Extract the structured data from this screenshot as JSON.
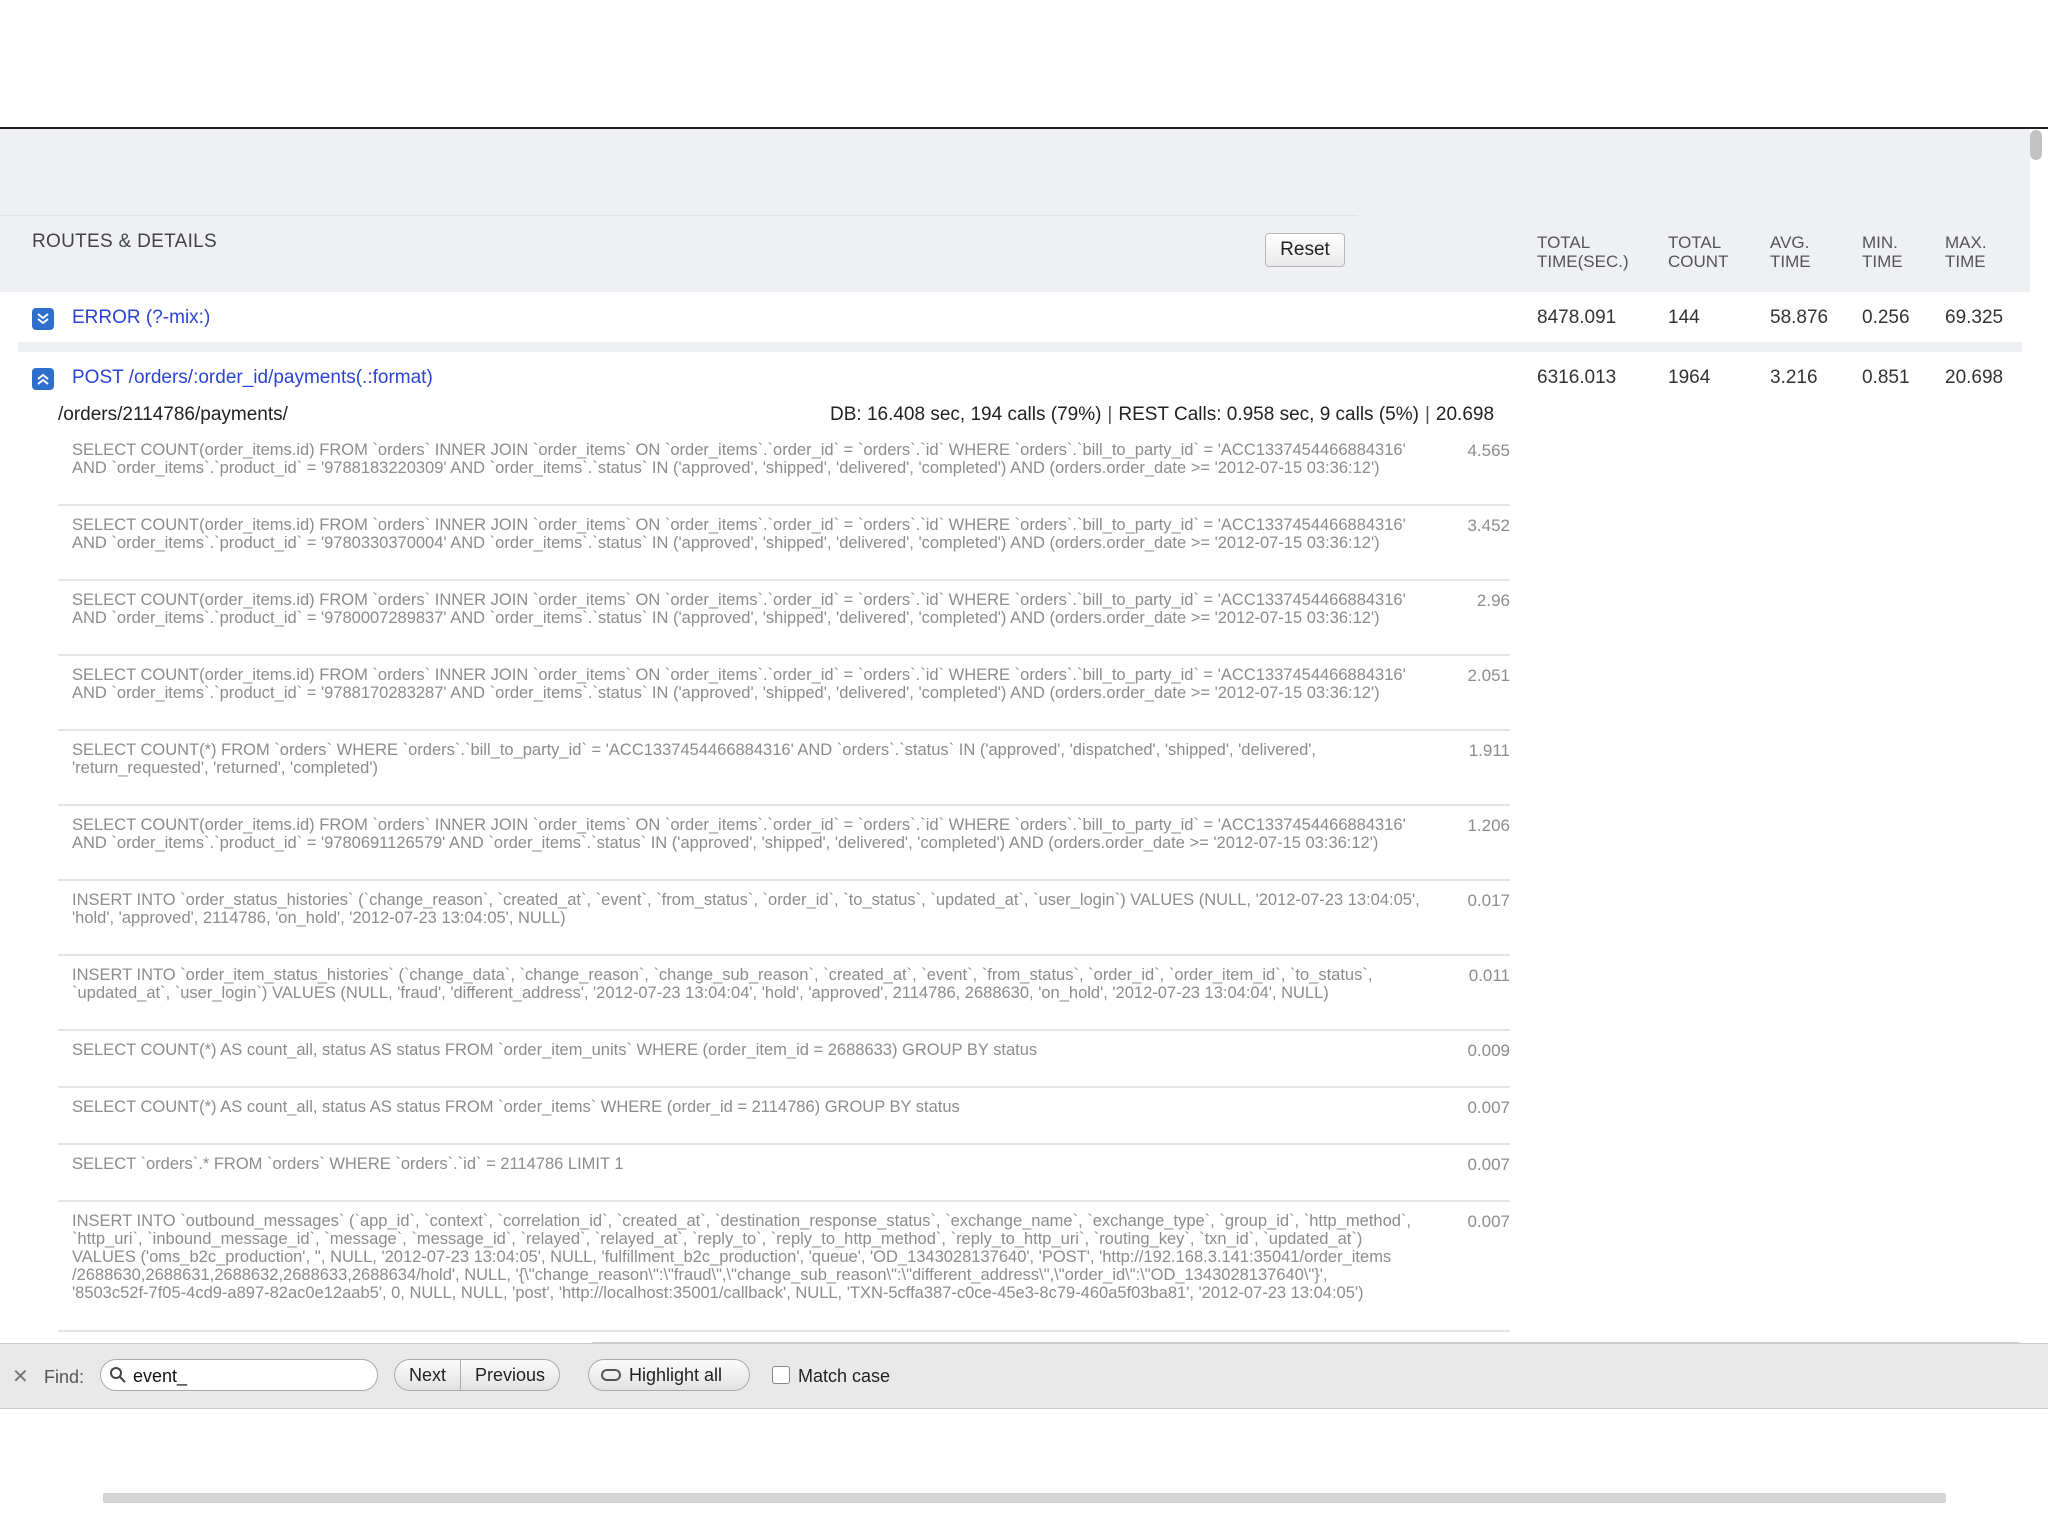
{
  "header": {
    "routes_label": "ROUTES & DETAILS",
    "reset_label": "Reset",
    "columns": [
      {
        "l1": "TOTAL",
        "l2": "TIME(SEC.)"
      },
      {
        "l1": "TOTAL",
        "l2": "COUNT"
      },
      {
        "l1": "AVG.",
        "l2": "TIME"
      },
      {
        "l1": "MIN.",
        "l2": "TIME"
      },
      {
        "l1": "MAX.",
        "l2": "TIME"
      }
    ]
  },
  "routes": [
    {
      "name": "ERROR (?-mix:)",
      "total_time": "8478.091",
      "total_count": "144",
      "avg": "58.876",
      "min": "0.256",
      "max": "69.325",
      "icon": "chevron-down-icon"
    },
    {
      "name": "POST /orders/:order_id/payments(.:format)",
      "total_time": "6316.013",
      "total_count": "1964",
      "avg": "3.216",
      "min": "0.851",
      "max": "20.698",
      "icon": "chevron-up-icon"
    }
  ],
  "detail": {
    "url": "/orders/2114786/payments/",
    "db": "DB: 16.408 sec, 194 calls (79%)",
    "rest": "REST Calls: 0.958 sec, 9 calls (5%)",
    "total": "20.698",
    "queries": [
      {
        "sql": "SELECT COUNT(order_items.id) FROM `orders` INNER JOIN `order_items` ON `order_items`.`order_id` = `orders`.`id` WHERE `orders`.`bill_to_party_id` = 'ACC1337454466884316'\nAND `order_items`.`product_id` = '9788183220309' AND `order_items`.`status` IN ('approved', 'shipped', 'delivered', 'completed') AND (orders.order_date >= '2012-07-15 03:36:12')",
        "time": "4.565"
      },
      {
        "sql": "SELECT COUNT(order_items.id) FROM `orders` INNER JOIN `order_items` ON `order_items`.`order_id` = `orders`.`id` WHERE `orders`.`bill_to_party_id` = 'ACC1337454466884316'\nAND `order_items`.`product_id` = '9780330370004' AND `order_items`.`status` IN ('approved', 'shipped', 'delivered', 'completed') AND (orders.order_date >= '2012-07-15 03:36:12')",
        "time": "3.452"
      },
      {
        "sql": "SELECT COUNT(order_items.id) FROM `orders` INNER JOIN `order_items` ON `order_items`.`order_id` = `orders`.`id` WHERE `orders`.`bill_to_party_id` = 'ACC1337454466884316'\nAND `order_items`.`product_id` = '9780007289837' AND `order_items`.`status` IN ('approved', 'shipped', 'delivered', 'completed') AND (orders.order_date >= '2012-07-15 03:36:12')",
        "time": "2.96"
      },
      {
        "sql": "SELECT COUNT(order_items.id) FROM `orders` INNER JOIN `order_items` ON `order_items`.`order_id` = `orders`.`id` WHERE `orders`.`bill_to_party_id` = 'ACC1337454466884316'\nAND `order_items`.`product_id` = '9788170283287' AND `order_items`.`status` IN ('approved', 'shipped', 'delivered', 'completed') AND (orders.order_date >= '2012-07-15 03:36:12')",
        "time": "2.051"
      },
      {
        "sql": "SELECT COUNT(*) FROM `orders` WHERE `orders`.`bill_to_party_id` = 'ACC1337454466884316' AND `orders`.`status` IN ('approved', 'dispatched', 'shipped', 'delivered',\n'return_requested', 'returned', 'completed')",
        "time": "1.911"
      },
      {
        "sql": "SELECT COUNT(order_items.id) FROM `orders` INNER JOIN `order_items` ON `order_items`.`order_id` = `orders`.`id` WHERE `orders`.`bill_to_party_id` = 'ACC1337454466884316'\nAND `order_items`.`product_id` = '9780691126579' AND `order_items`.`status` IN ('approved', 'shipped', 'delivered', 'completed') AND (orders.order_date >= '2012-07-15 03:36:12')",
        "time": "1.206"
      },
      {
        "sql": "INSERT INTO `order_status_histories` (`change_reason`, `created_at`, `event`, `from_status`, `order_id`, `to_status`, `updated_at`, `user_login`) VALUES (NULL, '2012-07-23 13:04:05',\n'hold', 'approved', 2114786, 'on_hold', '2012-07-23 13:04:05', NULL)",
        "time": "0.017"
      },
      {
        "sql": "INSERT INTO `order_item_status_histories` (`change_data`, `change_reason`, `change_sub_reason`, `created_at`, `event`, `from_status`, `order_id`, `order_item_id`, `to_status`,\n`updated_at`, `user_login`) VALUES (NULL, 'fraud', 'different_address', '2012-07-23 13:04:04', 'hold', 'approved', 2114786, 2688630, 'on_hold', '2012-07-23 13:04:04', NULL)",
        "time": "0.011"
      },
      {
        "sql": "SELECT COUNT(*) AS count_all, status AS status FROM `order_item_units` WHERE (order_item_id = 2688633) GROUP BY status",
        "time": "0.009"
      },
      {
        "sql": "SELECT COUNT(*) AS count_all, status AS status FROM `order_items` WHERE (order_id = 2114786) GROUP BY status",
        "time": "0.007"
      },
      {
        "sql": "SELECT `orders`.* FROM `orders` WHERE `orders`.`id` = 2114786 LIMIT 1",
        "time": "0.007"
      },
      {
        "sql": "INSERT INTO `outbound_messages` (`app_id`, `context`, `correlation_id`, `created_at`, `destination_response_status`, `exchange_name`, `exchange_type`, `group_id`, `http_method`,\n`http_uri`, `inbound_message_id`, `message`, `message_id`, `relayed`, `relayed_at`, `reply_to`, `reply_to_http_method`, `reply_to_http_uri`, `routing_key`, `txn_id`, `updated_at`)\nVALUES ('oms_b2c_production', '', NULL, '2012-07-23 13:04:05', NULL, 'fulfillment_b2c_production', 'queue', 'OD_1343028137640', 'POST', 'http://192.168.3.141:35041/order_items\n/2688630,2688631,2688632,2688633,2688634/hold', NULL, '{\\\"change_reason\\\":\\\"fraud\\\",\\\"change_sub_reason\\\":\\\"different_address\\\",\\\"order_id\\\":\\\"OD_1343028137640\\\"}',\n'8503c52f-7f05-4cd9-a897-82ac0e12aab5', 0, NULL, NULL, 'post', 'http://localhost:35001/callback', NULL, 'TXN-5cffa387-c0ce-45e3-8c79-460a5f03ba81', '2012-07-23 13:04:05')",
        "time": "0.007"
      }
    ]
  },
  "findbar": {
    "close_icon": "close-icon",
    "label": "Find:",
    "query": "event_",
    "next_label": "Next",
    "previous_label": "Previous",
    "highlight_label": "Highlight all",
    "match_case_label": "Match case"
  },
  "colors": {
    "link": "#2b44d8",
    "chevron": "#2f6fcc",
    "band": "#eef0f3"
  }
}
